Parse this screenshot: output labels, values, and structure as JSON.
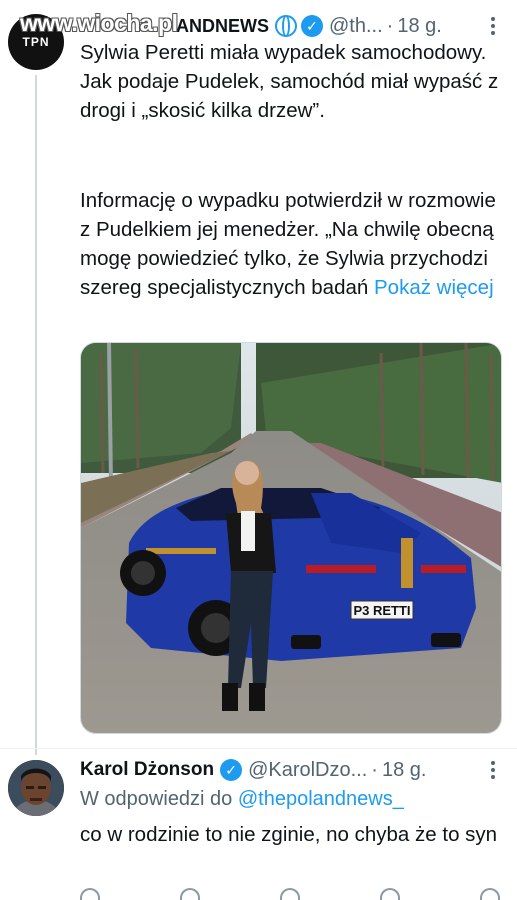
{
  "watermark": {
    "site": "www.wiocha.pl"
  },
  "tweet": {
    "avatar_label": "TPN",
    "author_name": "ANDNEWS",
    "handle": "@th...",
    "time": "18 g.",
    "paragraph1": "Sylwia Peretti miała wypadek samochodowy. Jak podaje Pudelek, samochód miał wypaść z drogi i „skosić kilka drzew”.",
    "paragraph2": "Informację o wypadku potwierdził w rozmowie z Pudelkiem jej menedżer. „Na chwilę obecną mogę powiedzieć tylko, że Sylwia przychodzi szereg specjalistycznych badań ",
    "show_more": "Pokaż więcej",
    "photo": {
      "plate": "P3 RETTI"
    }
  },
  "reply": {
    "author_name": "Karol Dżonson",
    "handle": "@KarolDzo...",
    "time": "18 g.",
    "replying_prefix": "W odpowiedzi do ",
    "replying_to": "@thepolandnews_",
    "text": "co w rodzinie to nie zginie, no chyba że to syn"
  },
  "colors": {
    "accent": "#1d9bf0",
    "text": "#0f1419",
    "muted": "#536471"
  },
  "icons": [
    "globe-icon",
    "verified-badge-icon",
    "more-options-icon"
  ]
}
